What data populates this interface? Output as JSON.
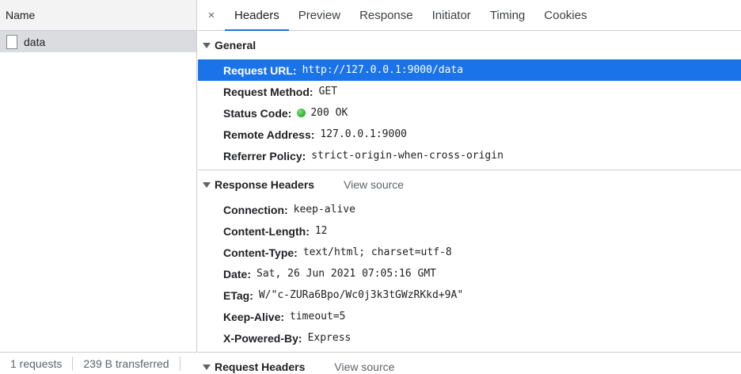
{
  "left": {
    "header": "Name",
    "requests": [
      {
        "name": "data"
      }
    ],
    "footer": {
      "requests": "1 requests",
      "transferred": "239 B transferred"
    }
  },
  "tabs": {
    "close_icon": "×",
    "items": [
      "Headers",
      "Preview",
      "Response",
      "Initiator",
      "Timing",
      "Cookies"
    ],
    "active": "Headers"
  },
  "general": {
    "title": "General",
    "rows": [
      {
        "key": "Request URL:",
        "value": "http://127.0.0.1:9000/data"
      },
      {
        "key": "Request Method:",
        "value": "GET"
      },
      {
        "key": "Status Code:",
        "value": "200 OK"
      },
      {
        "key": "Remote Address:",
        "value": "127.0.0.1:9000"
      },
      {
        "key": "Referrer Policy:",
        "value": "strict-origin-when-cross-origin"
      }
    ]
  },
  "response_headers": {
    "title": "Response Headers",
    "view_source": "View source",
    "rows": [
      {
        "key": "Connection:",
        "value": "keep-alive"
      },
      {
        "key": "Content-Length:",
        "value": "12"
      },
      {
        "key": "Content-Type:",
        "value": "text/html; charset=utf-8"
      },
      {
        "key": "Date:",
        "value": "Sat, 26 Jun 2021 07:05:16 GMT"
      },
      {
        "key": "ETag:",
        "value": "W/\"c-ZURa6Bpo/Wc0j3k3tGWzRKkd+9A\""
      },
      {
        "key": "Keep-Alive:",
        "value": "timeout=5"
      },
      {
        "key": "X-Powered-By:",
        "value": "Express"
      }
    ]
  },
  "request_headers": {
    "title": "Request Headers",
    "view_source": "View source"
  },
  "colors": {
    "accent": "#1a73e8",
    "status_ok": "#0b9a0b"
  }
}
